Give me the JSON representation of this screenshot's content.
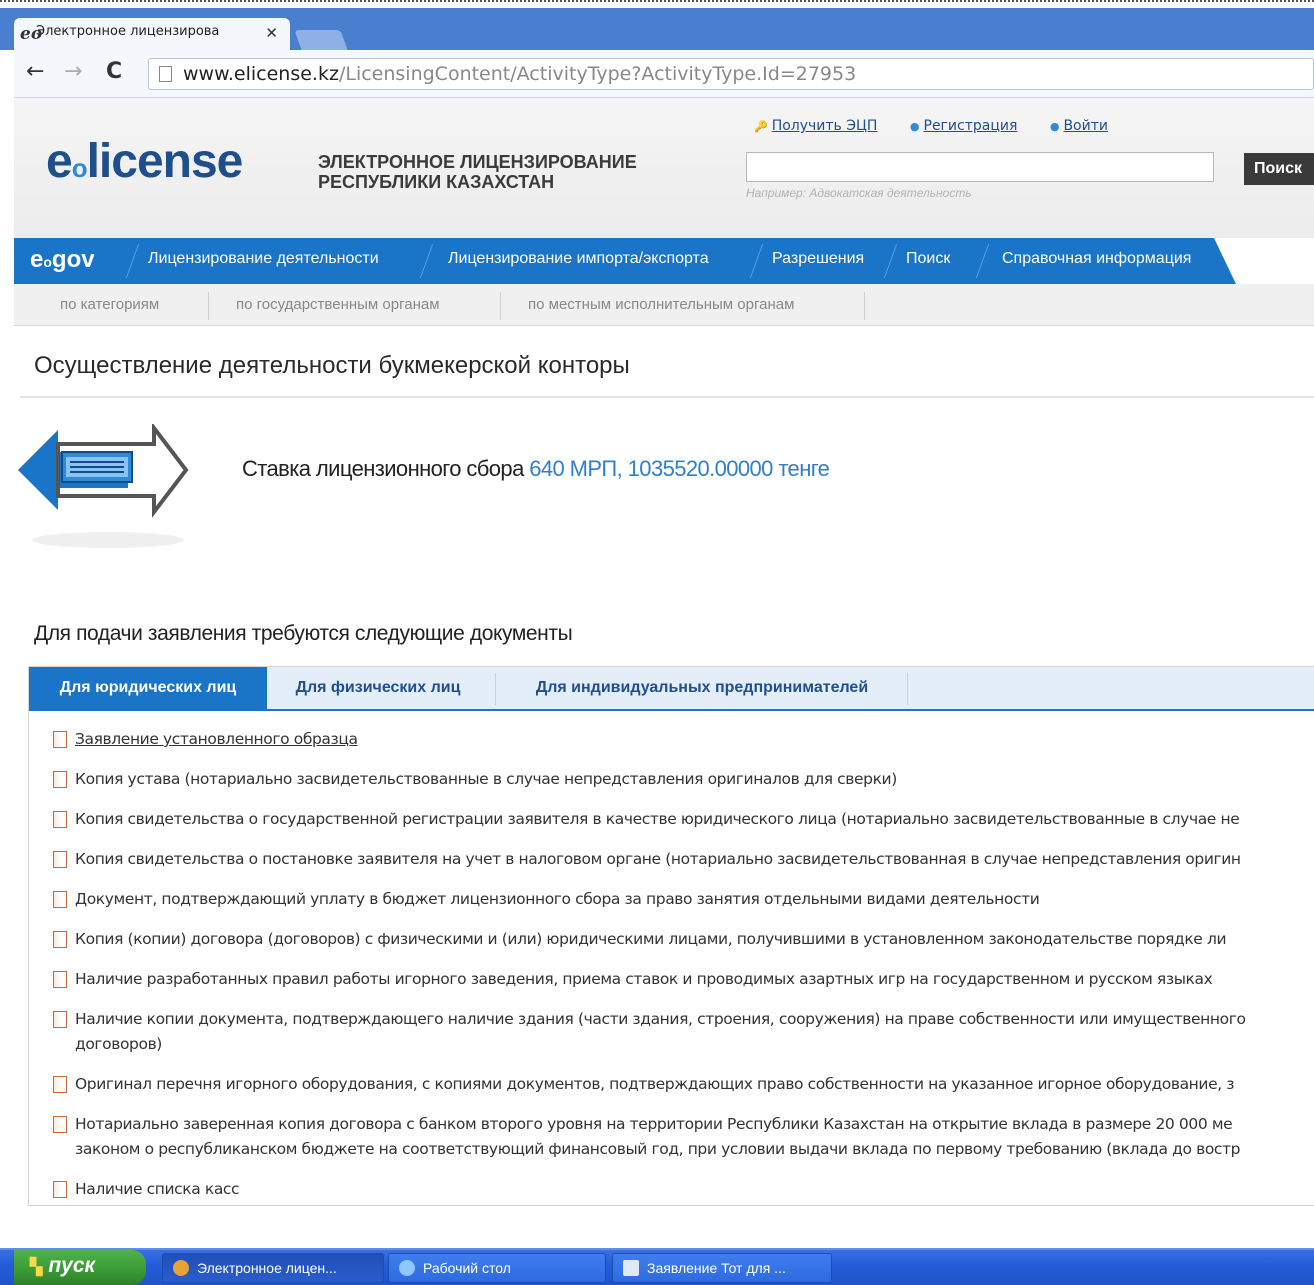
{
  "browser": {
    "tab_title": "Электронное лицензирова",
    "tab_favicon": "eo",
    "url_host": "www.elicense.kz",
    "url_path": "/LicensingContent/ActivityType?ActivityType.Id=27953"
  },
  "header": {
    "logo_e": "e",
    "logo_dot": "o",
    "logo_text": "license",
    "tagline_line1": "ЭЛЕКТРОННОЕ ЛИЦЕНЗИРОВАНИЕ",
    "tagline_line2": "РЕСПУБЛИКИ КАЗАХСТАН",
    "links": [
      {
        "label": "Получить ЭЦП",
        "icon": "key-icon"
      },
      {
        "label": "Регистрация",
        "icon": "key-icon"
      },
      {
        "label": "Войти",
        "icon": "key-icon"
      }
    ],
    "search_value": "",
    "search_button": "Поиск",
    "search_hint": "Например: Адвокатская деятельность"
  },
  "main_nav": {
    "egov_e": "e",
    "egov_dot": "o",
    "egov_text": "gov",
    "items": [
      "Лицензирование деятельности",
      "Лицензирование импорта/экспорта",
      "Разрешения",
      "Поиск",
      "Справочная информация"
    ]
  },
  "sub_nav": {
    "items": [
      "по категориям",
      "по государственным органам",
      "по местным исполнительным органам"
    ]
  },
  "page": {
    "title": "Осуществление деятельности букмекерской конторы",
    "fee_label": "Ставка лицензионного сбора",
    "fee_value": "640 МРП, 1035520.00000 тенге",
    "docs_heading": "Для подачи заявления требуются следующие документы"
  },
  "doc_tabs": [
    {
      "label": "Для юридических лиц",
      "active": true
    },
    {
      "label": "Для физических лиц",
      "active": false
    },
    {
      "label": "Для индивидуальных предпринимателей",
      "active": false
    }
  ],
  "documents": [
    {
      "text": "Заявление установленного образца",
      "link": true
    },
    {
      "text": "Копия устава (нотариально засвидетельствованные в случае непредставления оригиналов для сверки)"
    },
    {
      "text": "Копия свидетельства о государственной регистрации заявителя в качестве юридического лица (нотариально засвидетельствованные в случае не"
    },
    {
      "text": "Копия свидетельства о постановке заявителя на учет в налоговом органе (нотариально засвидетельствованная в случае непредставления оригин"
    },
    {
      "text": "Документ, подтверждающий уплату в бюджет лицензионного сбора за право занятия отдельными видами деятельности"
    },
    {
      "text": "Копия (копии) договора (договоров) с физическими и (или) юридическими лицами, получившими в установленном законодательстве порядке ли"
    },
    {
      "text": "Наличие разработанных правил работы игорного заведения, приема ставок и проводимых азартных игр на государственном и русском языках"
    },
    {
      "text": "Наличие копии документа, подтверждающего наличие здания (части здания, строения, сооружения) на праве собственности или имущественного",
      "text2": "договоров)"
    },
    {
      "text": "Оригинал перечня игорного оборудования, с копиями документов, подтверждающих право собственности на указанное игорное оборудование, з"
    },
    {
      "text": "Нотариально заверенная копия договора с банком второго уровня на территории Республики Казахстан на открытие вклада в размере 20 000 ме",
      "text2": "законом о республиканском бюджете на соответствующий финансовый год, при условии выдачи вклада по первому требованию (вклада до востр"
    },
    {
      "text": "Наличие списка касс"
    }
  ],
  "taskbar": {
    "start_label": "пуск",
    "items": [
      {
        "label": "Электронное лицен...",
        "icon": "chrome-icon",
        "color": "#e8a23a"
      },
      {
        "label": "Рабочий стол",
        "icon": "ie-icon",
        "color": "#8ec8ff"
      },
      {
        "label": "Заявление Тот для ...",
        "icon": "document-icon",
        "color": "#dfe8f5"
      }
    ]
  },
  "colors": {
    "brand_blue": "#1a74c7",
    "logo_blue": "#1e4e8c",
    "fee_link": "#2f7fc9"
  }
}
